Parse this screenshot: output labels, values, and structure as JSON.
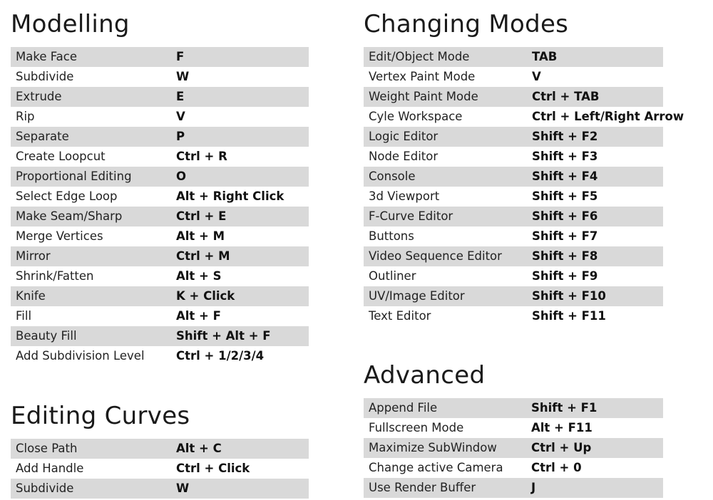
{
  "modelling": {
    "title": "Modelling",
    "rows": [
      {
        "action": "Make Face",
        "key": "F"
      },
      {
        "action": "Subdivide",
        "key": "W"
      },
      {
        "action": "Extrude",
        "key": "E"
      },
      {
        "action": "Rip",
        "key": "V"
      },
      {
        "action": "Separate",
        "key": "P"
      },
      {
        "action": "Create Loopcut",
        "key": "Ctrl + R"
      },
      {
        "action": "Proportional Editing",
        "key": "O"
      },
      {
        "action": "Select Edge Loop",
        "key": "Alt + Right Click"
      },
      {
        "action": "Make Seam/Sharp",
        "key": "Ctrl + E"
      },
      {
        "action": "Merge Vertices",
        "key": "Alt + M"
      },
      {
        "action": "Mirror",
        "key": "Ctrl + M"
      },
      {
        "action": "Shrink/Fatten",
        "key": "Alt + S"
      },
      {
        "action": "Knife",
        "key": "K + Click"
      },
      {
        "action": "Fill",
        "key": "Alt + F"
      },
      {
        "action": "Beauty Fill",
        "key": "Shift + Alt + F"
      },
      {
        "action": "Add Subdivision Level",
        "key": "Ctrl + 1/2/3/4"
      }
    ]
  },
  "editing_curves": {
    "title": "Editing Curves",
    "rows": [
      {
        "action": "Close Path",
        "key": "Alt + C"
      },
      {
        "action": "Add Handle",
        "key": "Ctrl + Click"
      },
      {
        "action": "Subdivide",
        "key": "W"
      }
    ]
  },
  "changing_modes": {
    "title": "Changing Modes",
    "rows": [
      {
        "action": "Edit/Object Mode",
        "key": "TAB"
      },
      {
        "action": "Vertex Paint Mode",
        "key": "V"
      },
      {
        "action": "Weight Paint Mode",
        "key": "Ctrl + TAB"
      },
      {
        "action": "Cyle Workspace",
        "key": "Ctrl + Left/Right Arrow"
      },
      {
        "action": "Logic Editor",
        "key": "Shift + F2"
      },
      {
        "action": "Node Editor",
        "key": "Shift + F3"
      },
      {
        "action": "Console",
        "key": "Shift + F4"
      },
      {
        "action": "3d Viewport",
        "key": "Shift + F5"
      },
      {
        "action": "F-Curve Editor",
        "key": "Shift + F6"
      },
      {
        "action": "Buttons",
        "key": "Shift + F7"
      },
      {
        "action": "Video Sequence Editor",
        "key": "Shift + F8"
      },
      {
        "action": "Outliner",
        "key": "Shift + F9"
      },
      {
        "action": "UV/Image Editor",
        "key": "Shift + F10"
      },
      {
        "action": "Text Editor",
        "key": "Shift + F11"
      }
    ]
  },
  "advanced": {
    "title": "Advanced",
    "rows": [
      {
        "action": "Append File",
        "key": "Shift + F1"
      },
      {
        "action": "Fullscreen Mode",
        "key": "Alt + F11"
      },
      {
        "action": "Maximize SubWindow",
        "key": "Ctrl + Up"
      },
      {
        "action": "Change active Camera",
        "key": "Ctrl + 0"
      },
      {
        "action": "Use Render Buffer",
        "key": "J"
      }
    ]
  },
  "colors": {
    "row_shade": "#d9d9d9",
    "background": "#ffffff",
    "text": "#1f1f1f"
  }
}
